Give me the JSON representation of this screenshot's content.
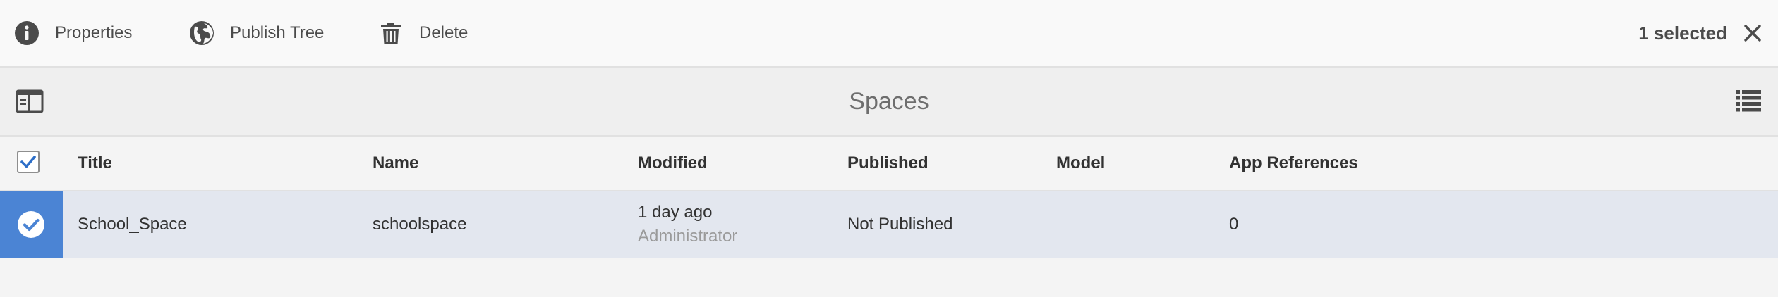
{
  "actionbar": {
    "properties": {
      "label": "Properties",
      "icon": "info-icon"
    },
    "publish_tree": {
      "label": "Publish Tree",
      "icon": "globe-icon"
    },
    "delete": {
      "label": "Delete",
      "icon": "trash-icon"
    },
    "selection_count": "1 selected"
  },
  "titlebar": {
    "title": "Spaces"
  },
  "table": {
    "columns": [
      "Title",
      "Name",
      "Modified",
      "Published",
      "Model",
      "App References"
    ],
    "rows": [
      {
        "title": "School_Space",
        "name": "schoolspace",
        "modified": "1 day ago",
        "modified_by": "Administrator",
        "published": "Not Published",
        "model": "",
        "app_references": "0",
        "selected": true
      }
    ]
  },
  "colors": {
    "selection_blue": "#4b84d4",
    "selected_row_bg": "#e3e7ef",
    "checkbox_check": "#2c6ec8"
  }
}
